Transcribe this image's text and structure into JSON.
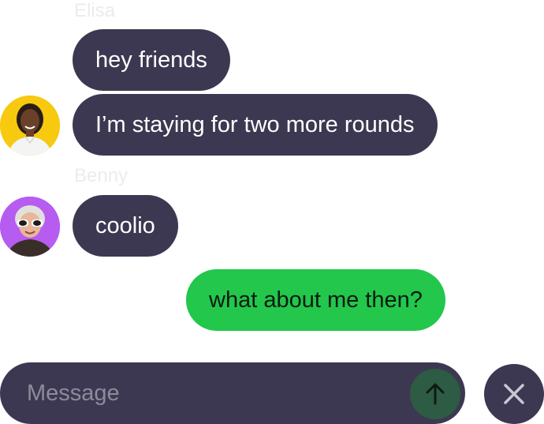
{
  "conversation": {
    "groups": [
      {
        "sender": "Elisa",
        "avatar_icon": "woman-portrait-avatar",
        "messages": [
          "hey friends",
          "I’m staying for two more rounds"
        ]
      },
      {
        "sender": "Benny",
        "avatar_icon": "older-woman-sunglasses-avatar",
        "messages": [
          "coolio"
        ]
      }
    ],
    "own_messages": [
      "what about me then?"
    ]
  },
  "composer": {
    "placeholder": "Message",
    "value": "",
    "send_icon": "arrow-up-icon",
    "close_icon": "close-icon"
  },
  "colors": {
    "bubble_other": "#3d3851",
    "bubble_own": "#22c74b",
    "send_button": "#2d5b43",
    "elisa_avatar_bg": "#f7c90f",
    "benny_avatar_bg": "#b65cf0",
    "sender_name": "#ececf0"
  }
}
